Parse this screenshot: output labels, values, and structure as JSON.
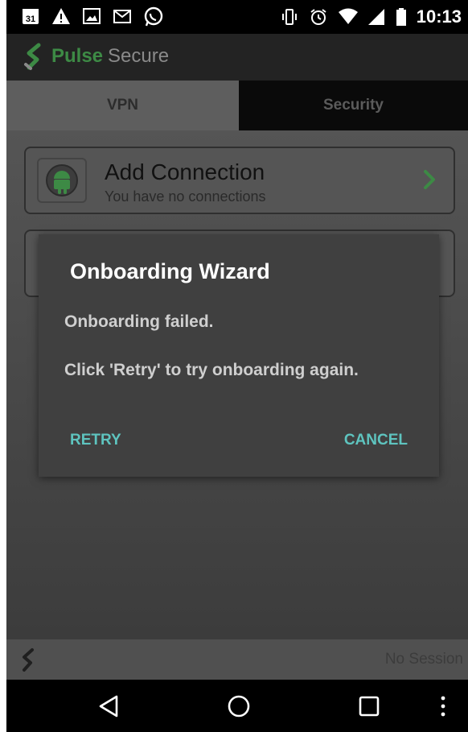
{
  "status_bar": {
    "calendar_day": "31",
    "time": "10:13",
    "left_icons": [
      "calendar-icon",
      "warning-icon",
      "image-icon",
      "gmail-icon",
      "whatsapp-icon"
    ],
    "right_icons": [
      "vibrate-icon",
      "alarm-icon",
      "wifi-icon",
      "signal-icon",
      "battery-icon"
    ]
  },
  "app_bar": {
    "brand_pulse": "Pulse",
    "brand_secure": "Secure",
    "brand_color": "#3d8a45"
  },
  "tabs": [
    {
      "label": "VPN",
      "selected": true
    },
    {
      "label": "Security",
      "selected": false
    }
  ],
  "connections": {
    "add_title": "Add Connection",
    "add_subtitle": "You have no connections"
  },
  "dialog": {
    "title": "Onboarding Wizard",
    "line1": "Onboarding failed.",
    "line2": "Click 'Retry' to try onboarding again.",
    "retry_label": "RETRY",
    "cancel_label": "CANCEL",
    "button_color": "#5ec4bf"
  },
  "footer": {
    "session_status": "No Session"
  },
  "nav_bar": {
    "icons": [
      "back-icon",
      "home-icon",
      "recents-icon",
      "more-icon"
    ]
  }
}
